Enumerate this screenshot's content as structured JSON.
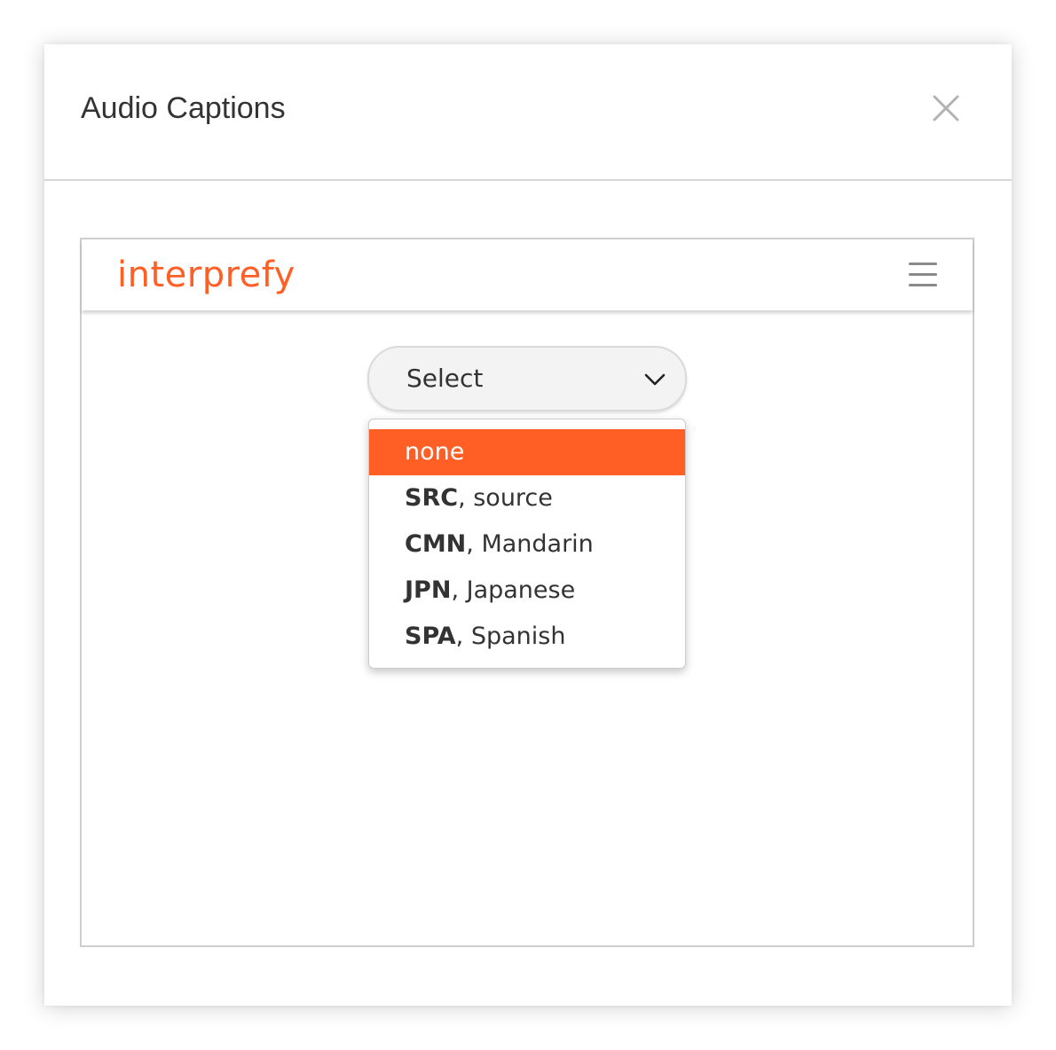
{
  "dialog": {
    "title": "Audio Captions",
    "close_icon": "close-icon"
  },
  "embed": {
    "brand": "interprefy",
    "brand_color": "#ff5e24",
    "menu_icon": "hamburger-menu-icon"
  },
  "select": {
    "label": "Select",
    "icon": "chevron-down-icon",
    "options": [
      {
        "text": "none",
        "selected": true
      },
      {
        "code": "SRC",
        "rest": ", source"
      },
      {
        "code": "CMN",
        "rest": ", Mandarin"
      },
      {
        "code": "JPN",
        "rest": ", Japanese"
      },
      {
        "code": "SPA",
        "rest": ", Spanish"
      }
    ]
  },
  "colors": {
    "accent": "#ff5e24",
    "text": "#333333",
    "border": "#cfcfcf"
  }
}
